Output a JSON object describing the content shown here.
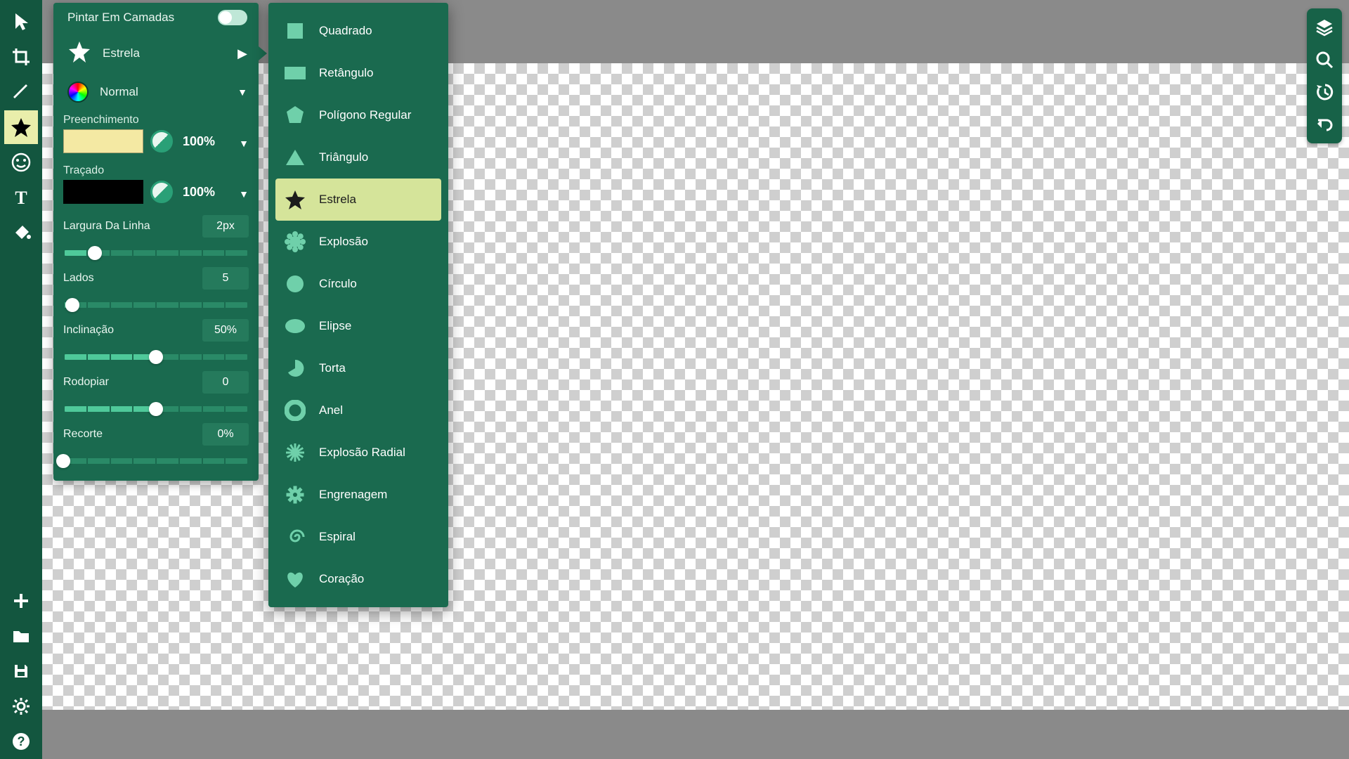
{
  "panel": {
    "paint_layers_label": "Pintar Em Camadas",
    "paint_layers_on": false,
    "selected_shape_label": "Estrela",
    "blend_mode_label": "Normal",
    "fill_section_label": "Preenchimento",
    "fill_opacity": "100%",
    "stroke_section_label": "Traçado",
    "stroke_opacity": "100%",
    "sliders": {
      "line_width": {
        "label": "Largura Da Linha",
        "value": "2px",
        "percent": 17
      },
      "sides": {
        "label": "Lados",
        "value": "5",
        "percent": 5
      },
      "inclination": {
        "label": "Inclinação",
        "value": "50%",
        "percent": 50
      },
      "whirl": {
        "label": "Rodopiar",
        "value": "0",
        "percent": 50
      },
      "cutout": {
        "label": "Recorte",
        "value": "0%",
        "percent": 0
      }
    }
  },
  "shapes_menu": [
    {
      "id": "square",
      "label": "Quadrado"
    },
    {
      "id": "rectangle",
      "label": "Retângulo"
    },
    {
      "id": "regular-polygon",
      "label": "Polígono Regular"
    },
    {
      "id": "triangle",
      "label": "Triângulo"
    },
    {
      "id": "star",
      "label": "Estrela",
      "active": true
    },
    {
      "id": "burst",
      "label": "Explosão"
    },
    {
      "id": "circle",
      "label": "Círculo"
    },
    {
      "id": "ellipse",
      "label": "Elipse"
    },
    {
      "id": "pie",
      "label": "Torta"
    },
    {
      "id": "ring",
      "label": "Anel"
    },
    {
      "id": "radial-burst",
      "label": "Explosão Radial"
    },
    {
      "id": "gear",
      "label": "Engrenagem"
    },
    {
      "id": "spiral",
      "label": "Espiral"
    },
    {
      "id": "heart",
      "label": "Coração"
    }
  ]
}
